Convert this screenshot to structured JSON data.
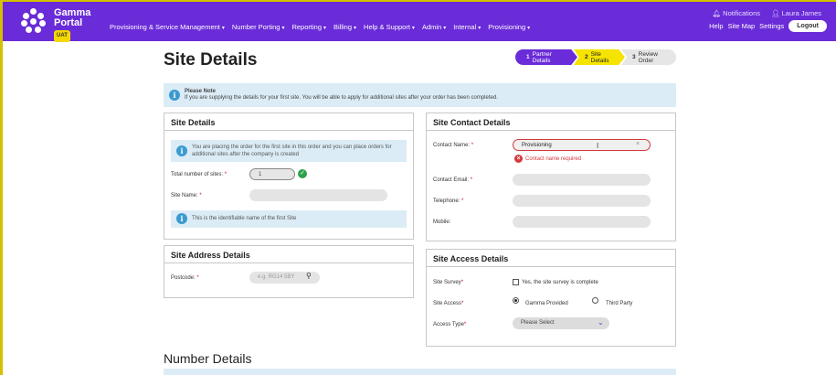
{
  "brand": {
    "line1": "Gamma",
    "line2": "Portal",
    "badge": "UAT"
  },
  "nav": [
    {
      "label": "Provisioning & Service Management"
    },
    {
      "label": "Number Porting"
    },
    {
      "label": "Reporting"
    },
    {
      "label": "Billing"
    },
    {
      "label": "Help & Support"
    },
    {
      "label": "Admin"
    },
    {
      "label": "Internal"
    },
    {
      "label": "Provisioning"
    }
  ],
  "topbar": {
    "notifications": "Notifications",
    "user": "Laura James"
  },
  "links": {
    "help": "Help",
    "sitemap": "Site Map",
    "settings": "Settings",
    "logout": "Logout"
  },
  "page": {
    "title": "Site Details"
  },
  "steps": [
    {
      "num": "1",
      "label": "Partner Details",
      "state": "complete"
    },
    {
      "num": "2",
      "label": "Site Details",
      "state": "current"
    },
    {
      "num": "3",
      "label": "Review Order",
      "state": "pending"
    }
  ],
  "notice": {
    "title": "Please Note",
    "text": "If you are supplying the details for your first site. You will be able to apply for additional sites after your order has been completed."
  },
  "site_details": {
    "heading": "Site Details",
    "info": "You are placing the order for the first site in this order and you can place orders for additional sites after the company is created",
    "total_label": "Total number of sites:",
    "total_value": "1",
    "name_label": "Site Name:",
    "name_value": "",
    "name_hint": "This is the identifiable name of the first Site"
  },
  "site_address": {
    "heading": "Site Address Details",
    "postcode_label": "Postcode:",
    "postcode_placeholder": "e.g. RG14 5BY"
  },
  "site_contact": {
    "heading": "Site Contact Details",
    "name_label": "Contact Name:",
    "name_value": "Provisioning",
    "name_error": "Contact name required",
    "email_label": "Contact Email:",
    "phone_label": "Telephone:",
    "mobile_label": "Mobile:"
  },
  "site_access": {
    "heading": "Site Access Details",
    "survey_label": "Site Survey",
    "survey_option": "Yes, the site survey is complete",
    "access_label": "Site Access",
    "access_option1": "Gamma Provided",
    "access_option2": "Third Party",
    "type_label": "Access Type",
    "type_value": "Please Select"
  },
  "number_details": {
    "heading": "Number Details"
  },
  "colors": {
    "brand": "#6a2bd8",
    "accent": "#f5e300",
    "info": "#dbecf6",
    "error": "#d4383b",
    "success": "#2ca24a"
  }
}
